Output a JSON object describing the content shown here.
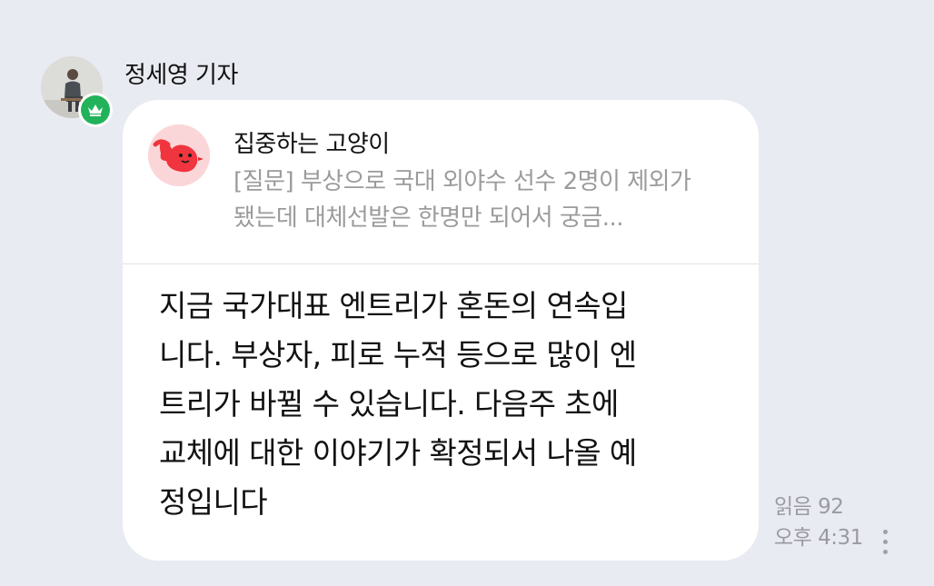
{
  "message": {
    "sender_name": "정세영 기자",
    "sender_badge_icon": "crown-icon",
    "badge_color": "#22b35a",
    "quote": {
      "author": "집중하는 고양이",
      "text": "[질문] 부상으로 국대 외야수 선수 2명이 제외가 됐는데 대체선발은 한명만 되어서 궁금..."
    },
    "body": "지금 국가대표 엔트리가 혼돈의 연속입\n니다. 부상자, 피로 누적 등으로 많이 엔\n트리가 바뀔 수 있습니다. 다음주 초에\n교체에 대한 이야기가 확정되서 나올 예\n정입니다",
    "read_count": "읽음 92",
    "time": "오후 4:31",
    "more_icon": "more-vertical-icon"
  },
  "colors": {
    "background": "#e9ebf2",
    "bubble": "#ffffff",
    "meta_text": "#9a9aa0",
    "quote_avatar_bg": "#fbd6d8",
    "quote_avatar_accent": "#f0353e"
  }
}
